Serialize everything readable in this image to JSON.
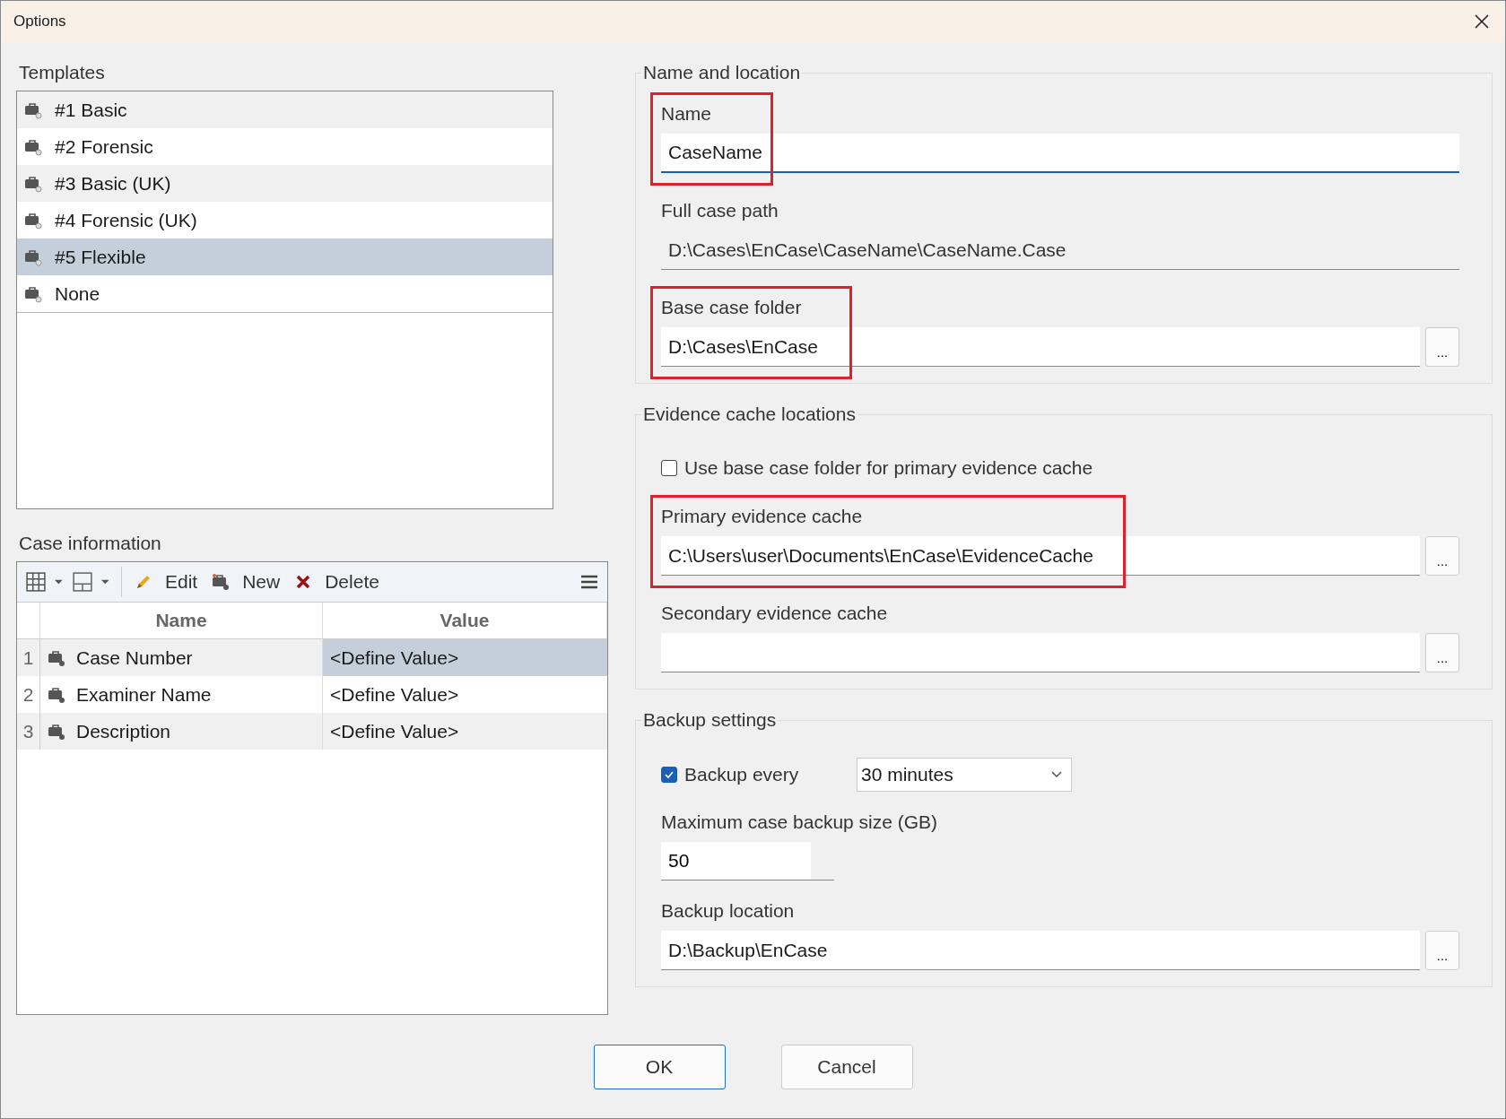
{
  "window": {
    "title": "Options"
  },
  "templates": {
    "label": "Templates",
    "items": [
      {
        "name": "#1 Basic",
        "selected": false
      },
      {
        "name": "#2 Forensic",
        "selected": false
      },
      {
        "name": "#3 Basic (UK)",
        "selected": false
      },
      {
        "name": "#4 Forensic (UK)",
        "selected": false
      },
      {
        "name": "#5 Flexible",
        "selected": true
      },
      {
        "name": "None",
        "selected": false
      }
    ]
  },
  "case_information": {
    "label": "Case information",
    "toolbar": [
      {
        "kind": "grid"
      },
      {
        "kind": "layout"
      },
      {
        "kind": "edit",
        "label": "Edit"
      },
      {
        "kind": "new",
        "label": "New"
      },
      {
        "kind": "delete",
        "label": "Delete"
      },
      {
        "kind": "menu"
      }
    ],
    "columns": [
      "Name",
      "Value"
    ],
    "rows": [
      {
        "number": "1",
        "name": "Case Number",
        "value": "<Define Value>",
        "selected": true
      },
      {
        "number": "2",
        "name": "Examiner Name",
        "value": "<Define Value>",
        "selected": false
      },
      {
        "number": "3",
        "name": "Description",
        "value": "<Define Value>",
        "selected": false
      }
    ]
  },
  "name_and_location": {
    "title": "Name and location",
    "fields": [
      {
        "label": "Name",
        "value": "CaseName",
        "highlighted": true,
        "focused": true,
        "readonly": false
      },
      {
        "label": "Full case path",
        "value": "D:\\Cases\\EnCase\\CaseName\\CaseName.Case",
        "highlighted": false,
        "focused": false,
        "readonly": true
      },
      {
        "label": "Base case folder",
        "value": "D:\\Cases\\EnCase",
        "highlighted": true,
        "focused": false,
        "readonly": false,
        "browse": "..."
      }
    ]
  },
  "evidence_cache": {
    "title": "Evidence cache locations",
    "use_base_folder": {
      "label": "Use base case folder for primary evidence cache",
      "checked": false
    },
    "fields": [
      {
        "label": "Primary evidence cache",
        "value": "C:\\Users\\user\\Documents\\EnCase\\EvidenceCache",
        "highlighted": true,
        "focused": false,
        "readonly": false,
        "browse": "..."
      },
      {
        "label": "Secondary evidence cache",
        "highlighted": false,
        "focused": false,
        "readonly": false,
        "browse": "..."
      }
    ]
  },
  "backup": {
    "title": "Backup settings",
    "backup_every": {
      "label": "Backup every",
      "checked": true,
      "interval": "30 minutes"
    },
    "max_size": {
      "label": "Maximum case backup size (GB)",
      "value": "50"
    },
    "location": {
      "label": "Backup location",
      "value": "D:\\Backup\\EnCase",
      "browse": "..."
    }
  },
  "buttons": [
    {
      "label": "OK",
      "default": true
    },
    {
      "label": "Cancel",
      "default": false
    }
  ]
}
